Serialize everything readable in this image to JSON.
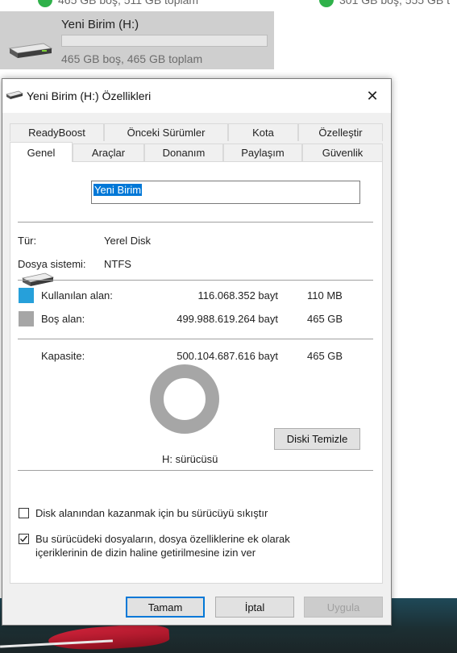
{
  "background": {
    "top_partial_left": "465 GB boş, 511 GB toplam",
    "top_partial_right": "301 GB boş, 555 GB t",
    "drive_tile": {
      "name": "Yeni Birim (H:)",
      "free_text": "465 GB boş, 465 GB toplam",
      "usage_fraction": 0.0,
      "icon": "hard-drive-icon"
    }
  },
  "dialog": {
    "title": "Yeni Birim (H:) Özellikleri",
    "title_icon": "drive-icon",
    "close_icon": "close-icon",
    "tabs_back": [
      "ReadyBoost",
      "Önceki Sürümler",
      "Kota",
      "Özelleştir"
    ],
    "tabs_front": [
      "Genel",
      "Araçlar",
      "Donanım",
      "Paylaşım",
      "Güvenlik"
    ],
    "selected_tab": "Genel",
    "volume_name": "Yeni Birim",
    "type_label": "Tür:",
    "type_value": "Yerel Disk",
    "fs_label": "Dosya sistemi:",
    "fs_value": "NTFS",
    "used": {
      "label": "Kullanılan alan:",
      "bytes": "116.068.352 bayt",
      "size": "110 MB",
      "color": "#26a0da"
    },
    "free": {
      "label": "Boş alan:",
      "bytes": "499.988.619.264 bayt",
      "size": "465 GB",
      "color": "#a6a6a6"
    },
    "capacity": {
      "label": "Kapasite:",
      "bytes": "500.104.687.616 bayt",
      "size": "465 GB"
    },
    "drive_caption": "H: sürücüsü",
    "cleanup_button": "Diski Temizle",
    "compress": {
      "label": "Disk alanından kazanmak için bu sürücüyü sıkıştır",
      "checked": false
    },
    "index": {
      "label_line1": "Bu sürücüdeki dosyaların, dosya özelliklerine ek olarak",
      "label_line2": "içeriklerinin de dizin haline getirilmesine izin ver",
      "checked": true
    },
    "buttons": {
      "ok": "Tamam",
      "cancel": "İptal",
      "apply": "Uygula"
    }
  }
}
